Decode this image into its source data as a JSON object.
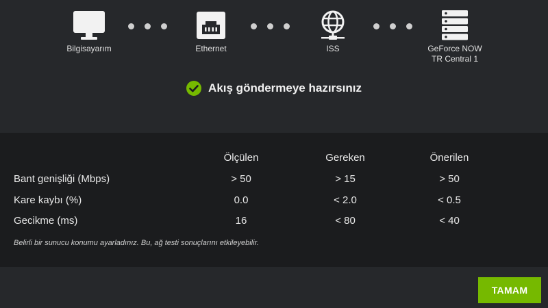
{
  "chain": {
    "nodes": [
      {
        "label": "Bilgisayarım",
        "icon": "monitor-icon"
      },
      {
        "label": "Ethernet",
        "icon": "ethernet-icon"
      },
      {
        "label": "ISS",
        "icon": "globe-network-icon"
      },
      {
        "label": "GeForce NOW",
        "label2": "TR Central 1",
        "icon": "server-icon"
      }
    ]
  },
  "status": {
    "text": "Akış göndermeye hazırsınız",
    "icon": "check-circle-icon",
    "color": "#76b900"
  },
  "table": {
    "headers": [
      "Ölçülen",
      "Gereken",
      "Önerilen"
    ],
    "rows": [
      {
        "label": "Bant genişliği (Mbps)",
        "values": [
          "> 50",
          "> 15",
          "> 50"
        ]
      },
      {
        "label": "Kare kaybı (%)",
        "values": [
          "0.0",
          "< 2.0",
          "< 0.5"
        ]
      },
      {
        "label": "Gecikme (ms)",
        "values": [
          "16",
          "< 80",
          "< 40"
        ]
      }
    ],
    "note": "Belirli bir sunucu konumu ayarladınız. Bu, ağ testi sonuçlarını etkileyebilir."
  },
  "footer": {
    "ok_label": "TAMAM",
    "accent": "#76b900"
  }
}
